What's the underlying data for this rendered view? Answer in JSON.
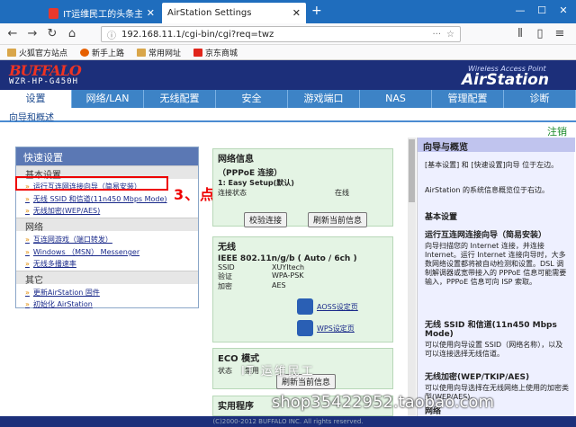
{
  "browser": {
    "tabs": [
      {
        "title": "IT运维民工的头条主页 - 今日头"
      },
      {
        "title": "AirStation Settings"
      }
    ],
    "url": "192.168.11.1/cgi-bin/cgi?req=twz",
    "bookmarks": [
      "火狐官方站点",
      "新手上路",
      "常用网址",
      "京东商城"
    ],
    "window_controls": [
      "—",
      "☐",
      "✕"
    ]
  },
  "router": {
    "brand": "BUFFALO",
    "model": "WZR-HP-G450H",
    "product_line": "Wireless Access Point",
    "product_name": "AirStation",
    "nav": [
      "设置",
      "网络/LAN",
      "无线配置",
      "安全",
      "游戏端口",
      "NAS",
      "管理配置",
      "诊断"
    ],
    "subnav": "向导和概述",
    "logout": "注销"
  },
  "left_panel": {
    "title": "快速设置",
    "basic": "基本设置",
    "links_basic": [
      "运行互连网连接向导（简易安装）",
      "无线 SSID 和信道(11n450 Mbps Mode)",
      "无线加密(WEP/AES)"
    ],
    "network": "网络",
    "links_network": [
      "互连网游戏（端口转发）",
      "Windows （MSN） Messenger",
      "无线多播速率"
    ],
    "other": "其它",
    "links_other": [
      "更新AirStation 固件",
      "初始化 AirStation"
    ],
    "annotation": "3、点击“连接向导”"
  },
  "center": {
    "net_title": "网络信息",
    "net_sub": "（PPPoE 连接）",
    "net_line": "1: Easy  Setup(默认)",
    "conn_key": "连接状态",
    "conn_val": "在线",
    "btn_check": "校验连接",
    "btn_refresh": "刷新当前信息",
    "wl_title": "无线",
    "wl_mode": "IEEE 802.11n/g/b ( Auto / 6ch )",
    "wl_rows": [
      {
        "k": "SSID",
        "v": "XUYItech"
      },
      {
        "k": "验证",
        "v": "WPA-PSK"
      },
      {
        "k": "加密",
        "v": "AES"
      }
    ],
    "aoss": "AOSS设定页",
    "wps": "WPS设定页",
    "eco_title": "ECO 模式",
    "eco_key": "状态",
    "eco_val": "禁用",
    "eco_refresh": "刷新当前信息",
    "util_title": "实用程序"
  },
  "help": {
    "title": "向导与概览",
    "intro": "[基本设置] 和 [快速设置]向导 位于左边。",
    "intro2": "AirStation 的系统信息概览位于右边。",
    "h1": "基本设置",
    "h2": "运行互连网连接向导（简易安装）",
    "p2": "向导扫描您的 Internet 连接，并连接 Internet。运行 Internet 连接向导时，大多数网络设置都将被自动检测和设置。DSL 调制解调器或宽带接入的 PPPoE 信息可能需要输入，PPPoE 信息可向 ISP 索取。",
    "h3": "无线 SSID 和信道(11n450 Mbps Mode)",
    "p3": "可以使用向导设置 SSID（网络名称），以及可以连接选择无线信道。",
    "h4": "无线加密(WEP/TKIP/AES)",
    "p4": "可以使用向导选择在无线网络上使用的加密类型(WEP/AES)。",
    "h5": "网络"
  },
  "overlay": {
    "watermark": "IT 运维民工",
    "shop": "shop35422952.taobao.com"
  },
  "footer": "(C)2000-2012 BUFFALO INC. All rights reserved."
}
